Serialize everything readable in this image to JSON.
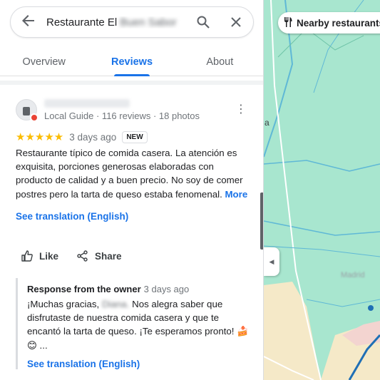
{
  "search": {
    "query_visible": "Restaurante El",
    "query_hidden": "Buen Sabor"
  },
  "tabs": [
    {
      "label": "Overview"
    },
    {
      "label": "Reviews"
    },
    {
      "label": "About"
    }
  ],
  "review": {
    "author_meta": "Local Guide · 116 reviews · 18 photos",
    "stars": "★★★★★",
    "rating": 5,
    "when": "3 days ago",
    "badge": "NEW",
    "text": "Restaurante típico de comida casera. La atención es exquisita, porciones generosas elaboradas con producto de calidad y a buen precio. No soy de comer postres pero la tarta de queso estaba fenomenal.",
    "more_label": "More",
    "see_translation": "See translation (English)",
    "like_label": "Like",
    "share_label": "Share"
  },
  "owner_response": {
    "title": "Response from the owner",
    "when": "3 days ago",
    "text_start": "¡Muchas gracias,",
    "text_hidden": "Diana.",
    "text_rest": "Nos alegra saber que disfrutaste de nuestra comida casera y que te encantó la tarta de queso. ¡Te esperamos pronto! 🍰 😊 ...",
    "see_translation": "See translation (English)"
  },
  "map": {
    "nearby_chip": "Nearby restaurants",
    "edge_letter": "a",
    "blurred_label": "Madrid"
  },
  "colors": {
    "accent": "#1a73e8",
    "star": "#fbbc04",
    "map_green": "#a8e6cf",
    "road_blue": "#5fb8d6"
  }
}
